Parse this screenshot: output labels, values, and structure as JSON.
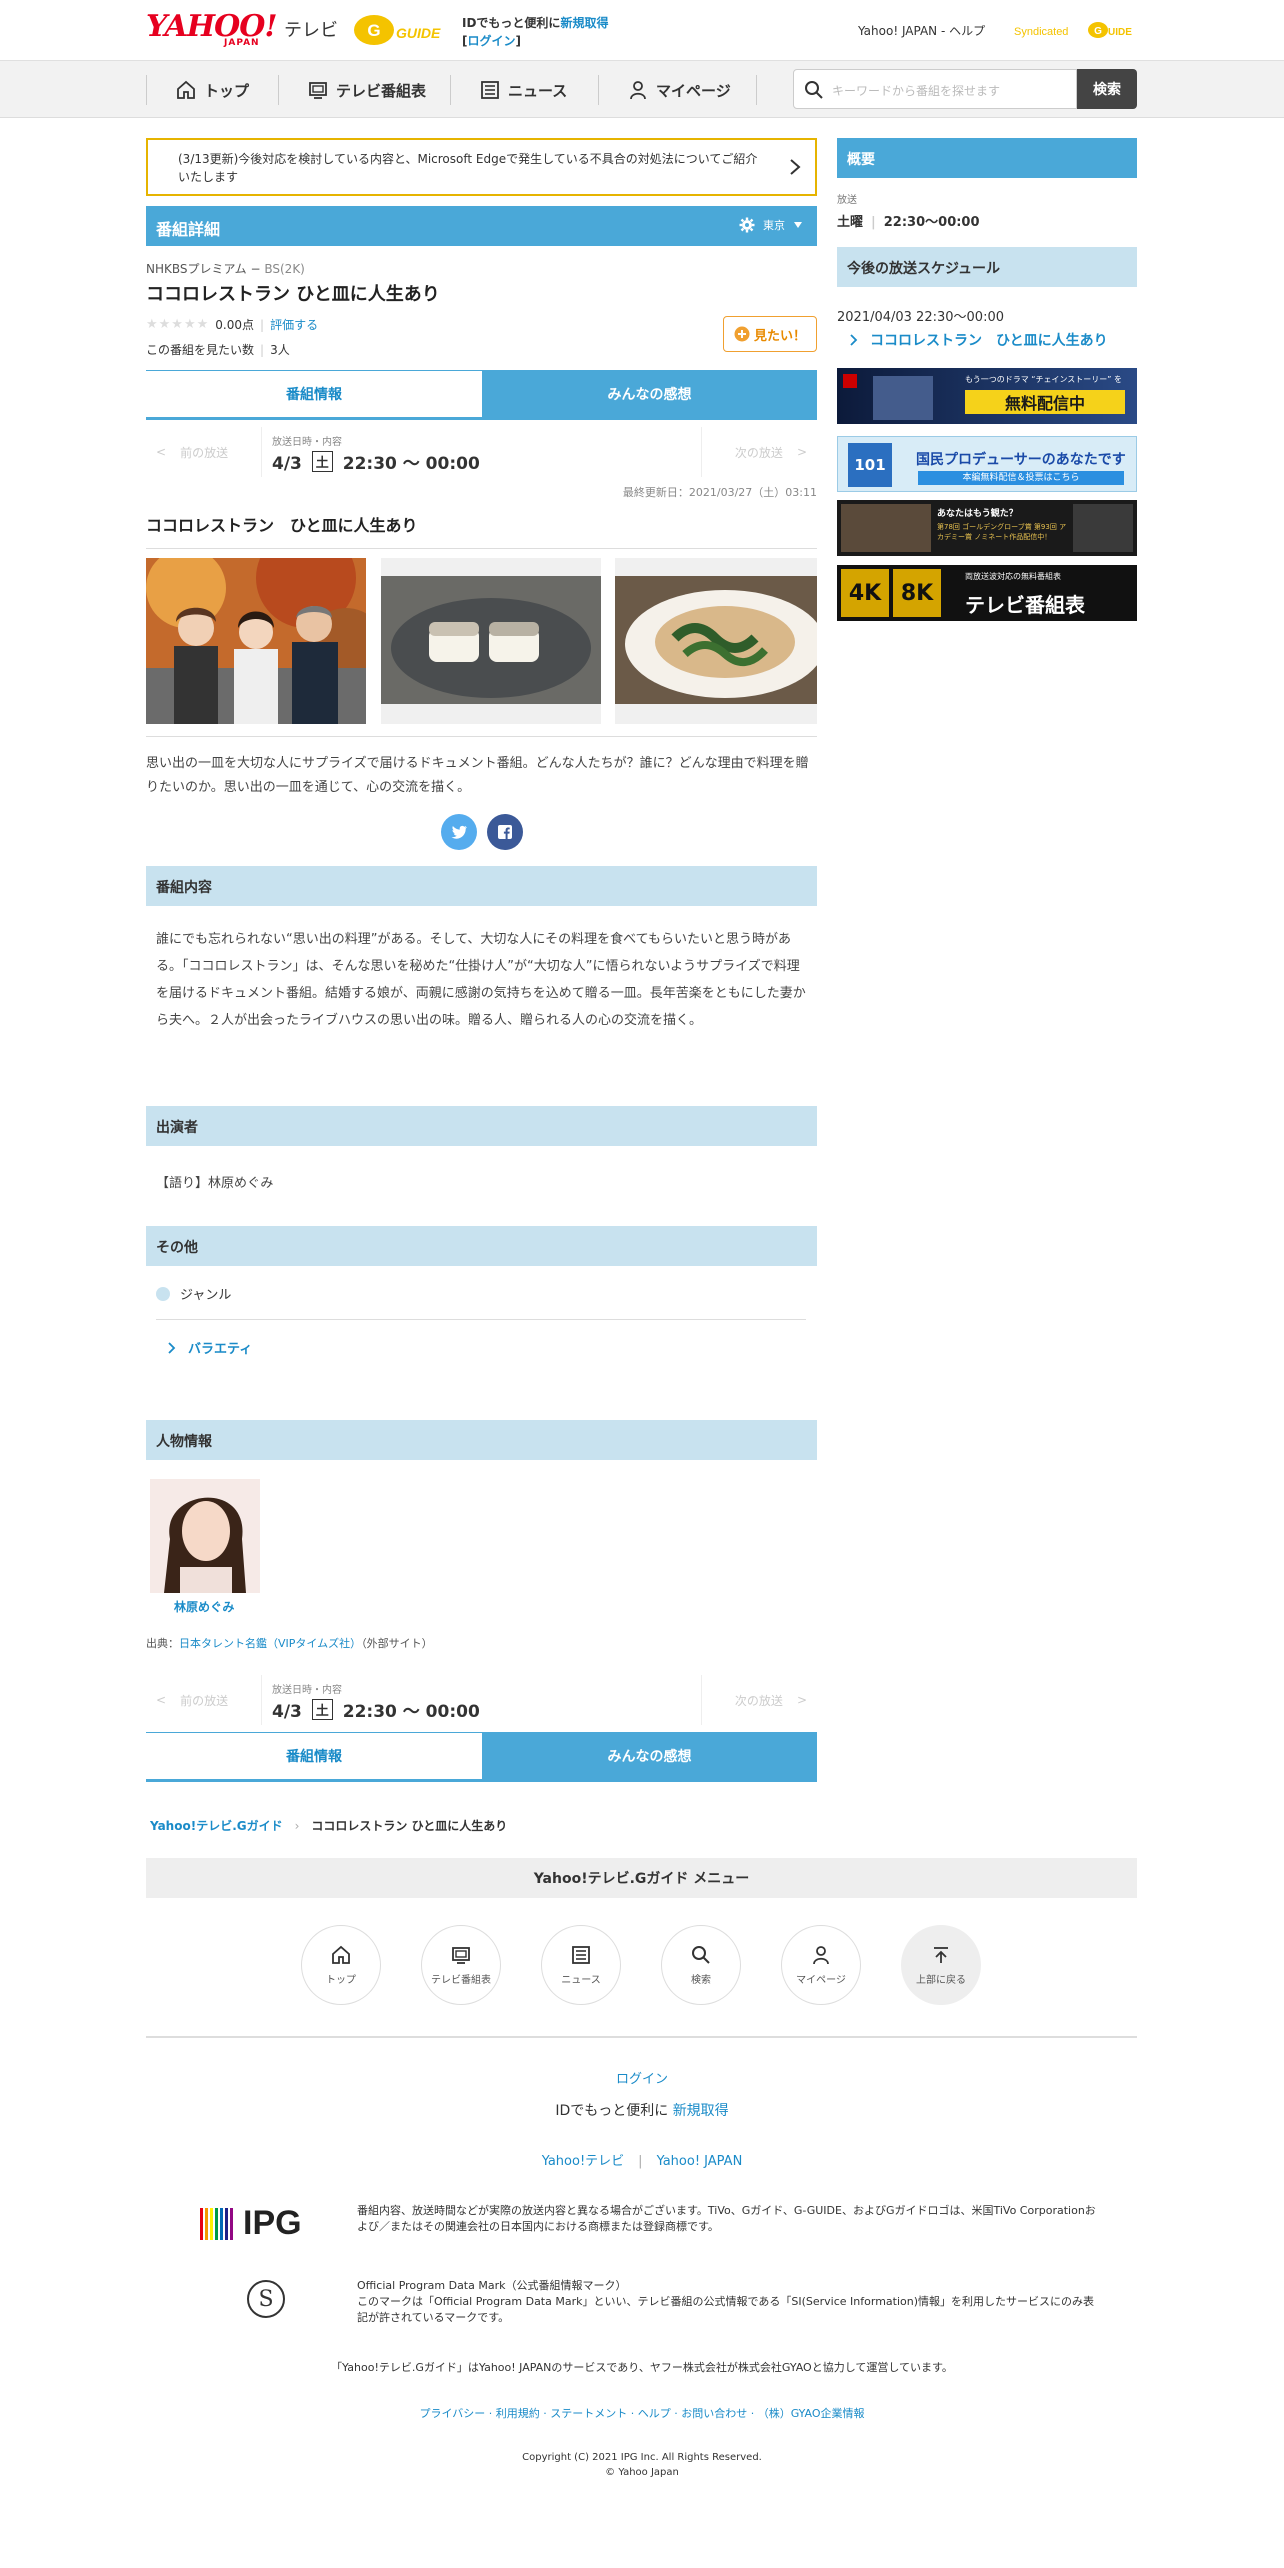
{
  "header": {
    "logo_yahoo": "YAHOO!",
    "logo_japan": "JAPAN",
    "logo_tv": "テレビ",
    "gguide_logo": "G GUIDE",
    "id_message_pre": "IDでもっと便利に",
    "signup_link": "新規取得",
    "login_link": "ログイン",
    "yahoo_japan_link": "Yahoo! JAPAN",
    "help_link": "ヘルプ",
    "syndicated": "Syndicated"
  },
  "nav": {
    "items": [
      {
        "label": "トップ",
        "icon": "home-icon"
      },
      {
        "label": "テレビ番組表",
        "icon": "tv-icon"
      },
      {
        "label": "ニュース",
        "icon": "news-icon"
      },
      {
        "label": "マイページ",
        "icon": "user-icon"
      }
    ],
    "search_placeholder": "キーワードから番組を探せます",
    "search_button": "検索"
  },
  "notice": "(3/13更新)今後対応を検討している内容と、Microsoft Edgeで発生している不具合の対処法についてご紹介いたします",
  "program": {
    "section_title": "番組詳細",
    "region": "東京",
    "channel": "NHKBSプレミアム",
    "channel_sub": "BS(2K)",
    "title": "ココロレストラン ひと皿に人生あり",
    "score": "0.00点",
    "rate_link": "評価する",
    "want_label": "この番組を見たい数",
    "want_count": "3人",
    "want_button": "見たい！",
    "tab_info": "番組情報",
    "tab_reviews": "みんなの感想",
    "prev_label": "前の放送",
    "next_label": "次の放送",
    "broadcast_label": "放送日時・内容",
    "broadcast_date": "4/3",
    "broadcast_day": "土",
    "broadcast_time": "22:30 〜 00:00",
    "updated": "最終更新日：2021/03/27（土）03:11",
    "subtitle": "ココロレストラン　ひと皿に人生あり",
    "description": "思い出の一皿を大切な人にサプライズで届けるドキュメント番組。どんな人たちが？誰に？どんな理由で料理を贈りたいのか。思い出の一皿を通じて、心の交流を描く。",
    "content_title": "番組内容",
    "content": "誰にでも忘れられない“思い出の料理”がある。そして、大切な人にその料理を食べてもらいたいと思う時がある。「ココロレストラン」は、そんな思いを秘めた“仕掛け人”が“大切な人”に悟られないようサプライズで料理を届けるドキュメント番組。結婚する娘が、両親に感謝の気持ちを込めて贈る一皿。長年苦楽をともにした妻から夫へ。２人が出会ったライブハウスの思い出の味。贈る人、贈られる人の心の交流を描く。",
    "cast_title": "出演者",
    "cast": "【語り】林原めぐみ",
    "other_title": "その他",
    "genre_label": "ジャンル",
    "genre": "バラエティ",
    "person_title": "人物情報",
    "person_name": "林原めぐみ",
    "source_pre": "出典：",
    "source_link": "日本タレント名鑑（VIPタイムズ社）",
    "source_post": "（外部サイト）"
  },
  "sidebar": {
    "overview_title": "概要",
    "broadcast_label": "放送",
    "day": "土曜",
    "time": "22:30～00:00",
    "schedule_title": "今後の放送スケジュール",
    "schedule_date": "2021/04/03 22:30～00:00",
    "schedule_link": "ココロレストラン　ひと皿に人生あり",
    "ads": [
      {
        "text": "無料配信中",
        "sub": "もう一つのドラマ “チェインストーリー” を"
      },
      {
        "text": "国民プロデューサーのあなたです",
        "sub": "本編無料配信＆投票はこちら"
      },
      {
        "text": "あなたはもう観た？",
        "sub": "第78回 ゴールデングローブ賞 第93回 アカデミー賞 ノミネート作品配信中！"
      },
      {
        "text": "テレビ番組表",
        "sub": "両放送波対応の無料番組表"
      }
    ]
  },
  "breadcrumb": {
    "root": "Yahoo!テレビ.Gガイド",
    "current": "ココロレストラン ひと皿に人生あり"
  },
  "footer": {
    "menu_title": "Yahoo!テレビ.Gガイド メニュー",
    "circles": [
      {
        "label": "トップ",
        "icon": "home-icon"
      },
      {
        "label": "テレビ番組表",
        "icon": "tv-icon"
      },
      {
        "label": "ニュース",
        "icon": "news-icon"
      },
      {
        "label": "検索",
        "icon": "search-icon"
      },
      {
        "label": "マイページ",
        "icon": "user-icon"
      },
      {
        "label": "上部に戻る",
        "icon": "arrow-up-icon"
      }
    ],
    "login": "ログイン",
    "id_pre": "IDでもっと便利に",
    "signup": "新規取得",
    "link_tv": "Yahoo!テレビ",
    "link_yj": "Yahoo! JAPAN",
    "ipg_logo": "IPG",
    "ipg_text": "番組内容、放送時間などが実際の放送内容と異なる場合がございます。TiVo、Gガイド、G-GUIDE、およびGガイドロゴは、米国TiVo Corporationおよび／またはその関連会社の日本国内における商標または登録商標です。",
    "mark_title": "Official Program Data Mark（公式番組情報マーク）",
    "mark_text": "このマークは「Official Program Data Mark」といい、テレビ番組の公式情報である「SI(Service Information)情報」を利用したサービスにのみ表記が許されているマークです。",
    "service_note": "「Yahoo!テレビ.Gガイド」はYahoo! JAPANのサービスであり、ヤフー株式会社が株式会社GYAOと協力して運営しています。",
    "links": "プライバシー · 利用規約 · ステートメント · ヘルプ · お問い合わせ · （株）GYAO企業情報",
    "copyright1": "Copyright (C) 2021 IPG Inc. All Rights Reserved.",
    "copyright2": "© Yahoo Japan"
  }
}
